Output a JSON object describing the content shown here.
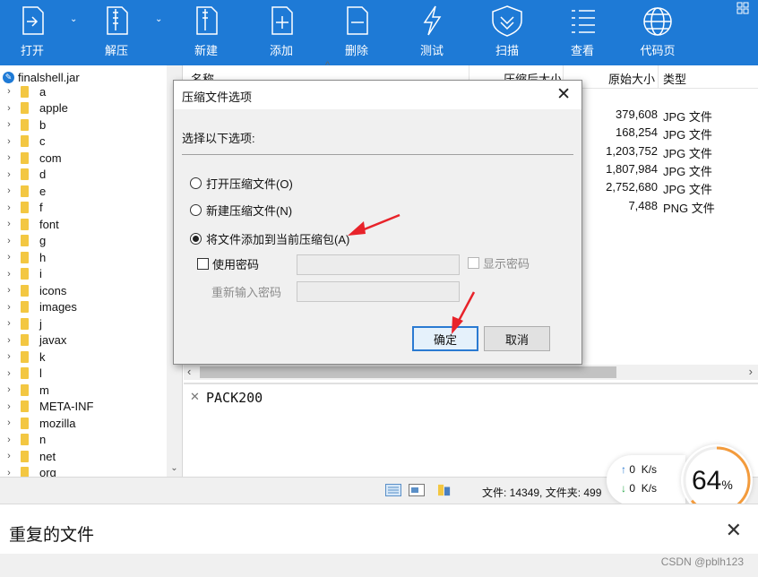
{
  "toolbar": {
    "buttons": [
      {
        "label": "打开",
        "icon": "open-icon"
      },
      {
        "label": "解压",
        "icon": "extract-icon"
      },
      {
        "label": "新建",
        "icon": "new-icon"
      },
      {
        "label": "添加",
        "icon": "add-icon"
      },
      {
        "label": "删除",
        "icon": "delete-icon"
      },
      {
        "label": "测试",
        "icon": "test-icon"
      },
      {
        "label": "扫描",
        "icon": "scan-shield-icon"
      },
      {
        "label": "查看",
        "icon": "view-list-icon"
      },
      {
        "label": "代码页",
        "icon": "globe-icon"
      }
    ],
    "accent": "#1e7ad6"
  },
  "tree": {
    "root": "finalshell.jar",
    "items": [
      "a",
      "apple",
      "b",
      "c",
      "com",
      "d",
      "e",
      "f",
      "font",
      "g",
      "h",
      "i",
      "icons",
      "images",
      "j",
      "javax",
      "k",
      "l",
      "m",
      "META-INF",
      "mozilla",
      "n",
      "net",
      "org"
    ]
  },
  "list": {
    "columns": {
      "name": "名称",
      "packed": "压缩后大小",
      "size": "原始大小",
      "type": "类型"
    },
    "rows": [
      {
        "size": "379,608",
        "type": "JPG 文件"
      },
      {
        "size": "168,254",
        "type": "JPG 文件"
      },
      {
        "size": "1,203,752",
        "type": "JPG 文件"
      },
      {
        "size": "1,807,984",
        "type": "JPG 文件"
      },
      {
        "size": "2,752,680",
        "type": "JPG 文件"
      },
      {
        "size": "7,488",
        "type": "PNG 文件"
      }
    ]
  },
  "info": {
    "text": "PACK200"
  },
  "status": {
    "text": "文件: 14349, 文件夹: 499"
  },
  "net": {
    "up": "0",
    "down": "0",
    "unit": "K/s",
    "percent": "64",
    "percent_sign": "%"
  },
  "dialog": {
    "title": "压缩文件选项",
    "prompt": "选择以下选项:",
    "options": [
      "打开压缩文件(O)",
      "新建压缩文件(N)",
      "将文件添加到当前压缩包(A)"
    ],
    "selected_index": 2,
    "use_password": "使用密码",
    "show_password": "显示密码",
    "reenter_password": "重新输入密码",
    "ok": "确定",
    "cancel": "取消"
  },
  "bottom": {
    "title": "重复的文件"
  },
  "watermark": "CSDN @pblh123"
}
